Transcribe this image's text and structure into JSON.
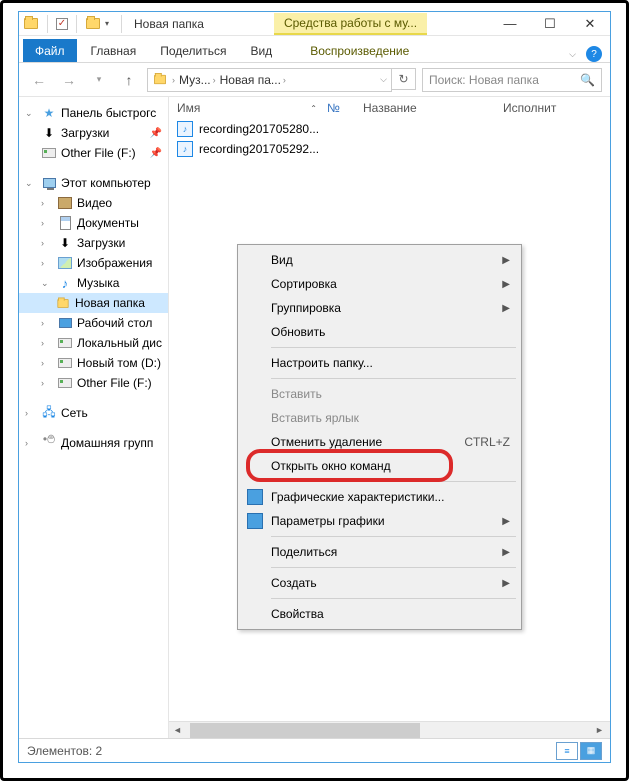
{
  "title": "Новая папка",
  "ribbon_context": "Средства работы с му...",
  "tabs": {
    "file": "Файл",
    "home": "Главная",
    "share": "Поделиться",
    "view": "Вид",
    "play": "Воспроизведение"
  },
  "address": {
    "crumb1": "Муз...",
    "crumb2": "Новая па...",
    "search_placeholder": "Поиск: Новая папка"
  },
  "sidebar": {
    "quick": "Панель быстрогс",
    "downloads": "Загрузки",
    "otherfile": "Other File (F:)",
    "thispc": "Этот компьютер",
    "video": "Видео",
    "documents": "Документы",
    "downloads2": "Загрузки",
    "pictures": "Изображения",
    "music": "Музыка",
    "newfolder": "Новая папка",
    "desktop": "Рабочий стол",
    "localdisk": "Локальный дис",
    "newvol": "Новый том (D:)",
    "otherfile2": "Other File (F:)",
    "network": "Сеть",
    "homegroup": "Домашняя групп"
  },
  "columns": {
    "name": "Имя",
    "num": "№",
    "title": "Название",
    "artist": "Исполнит"
  },
  "files": [
    {
      "name": "recording201705280..."
    },
    {
      "name": "recording201705292..."
    }
  ],
  "ctx": {
    "view": "Вид",
    "sort": "Сортировка",
    "group": "Группировка",
    "refresh": "Обновить",
    "customize": "Настроить папку...",
    "paste": "Вставить",
    "paste_shortcut": "Вставить ярлык",
    "undo": "Отменить удаление",
    "undo_key": "CTRL+Z",
    "open_cmd": "Открыть окно команд",
    "gfx1": "Графические характеристики...",
    "gfx2": "Параметры графики",
    "share": "Поделиться",
    "new": "Создать",
    "props": "Свойства"
  },
  "status": {
    "items": "Элементов: 2"
  }
}
